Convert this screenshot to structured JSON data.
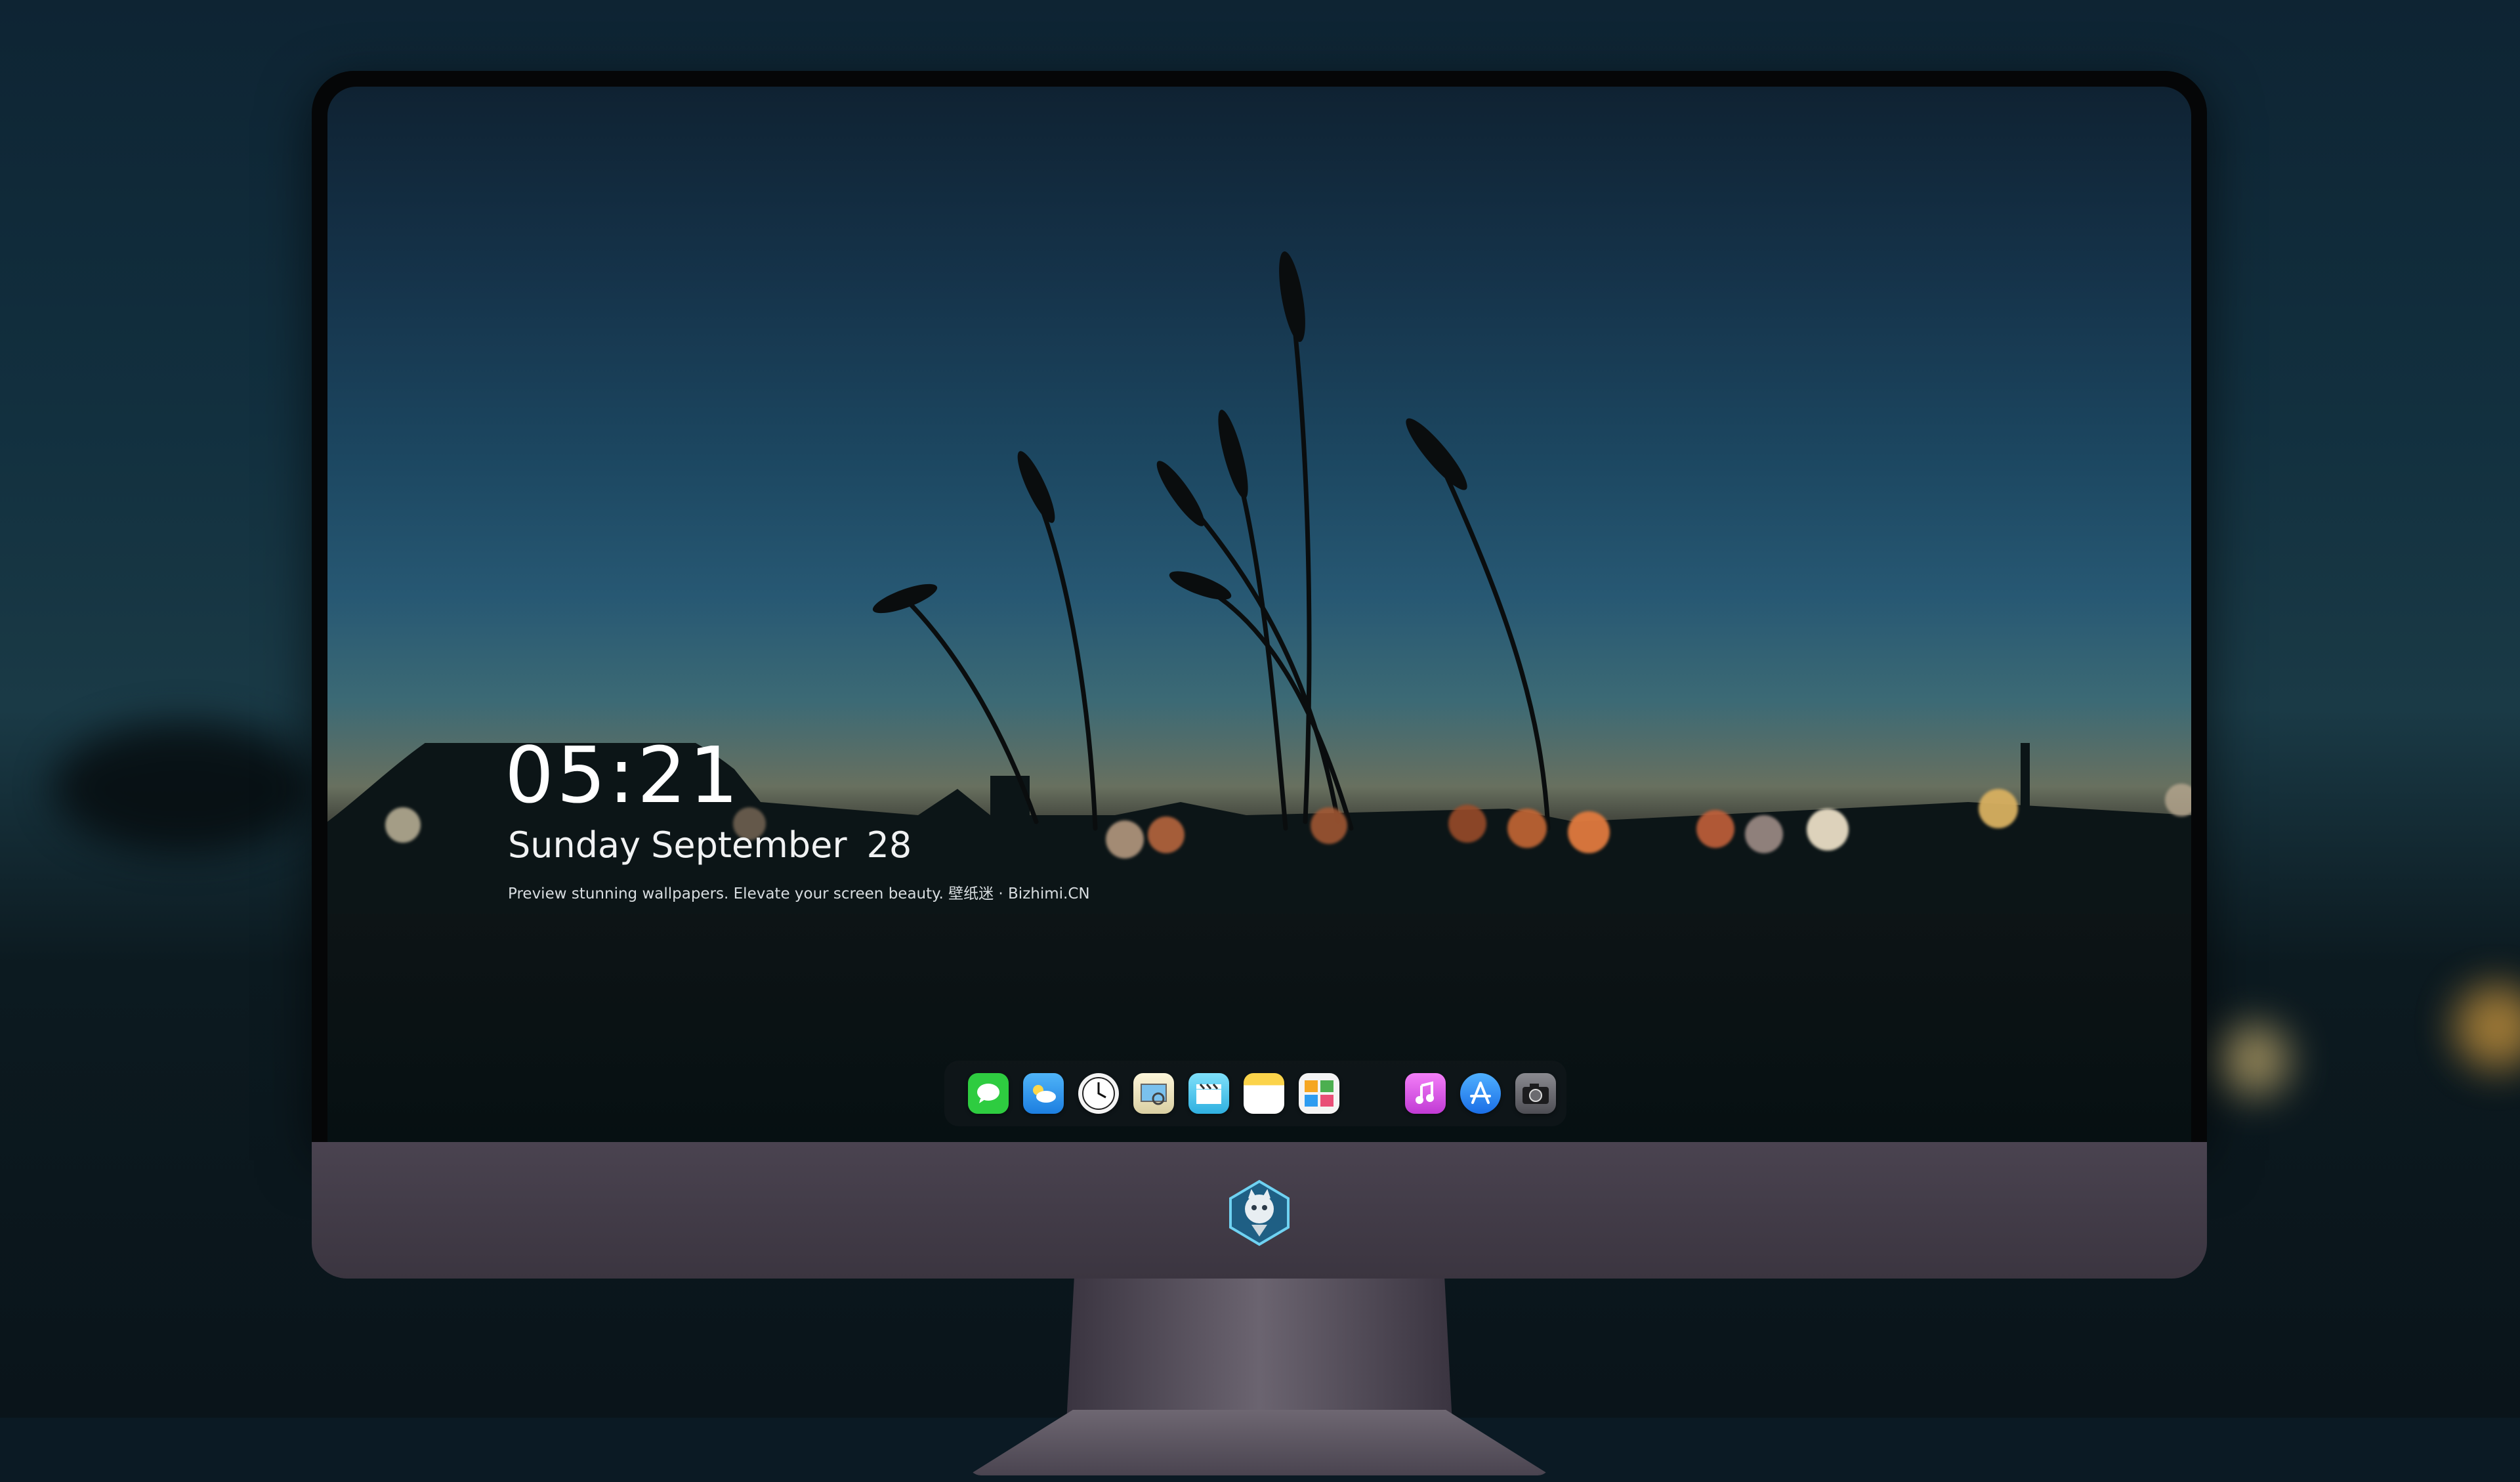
{
  "lockscreen": {
    "time": "05:21",
    "weekday": "Sunday",
    "month": "September",
    "day": "28",
    "tagline": "Preview stunning wallpapers. Elevate your screen beauty. 壁纸迷 · Bizhimi.CN"
  },
  "dock": {
    "apps": [
      {
        "name": "Messages",
        "icon": "messages-icon",
        "color": "#2ecc40"
      },
      {
        "name": "Weather",
        "icon": "weather-icon",
        "color": "#2d9cf0"
      },
      {
        "name": "Clock",
        "icon": "clock-icon",
        "color": "#f4f4f4"
      },
      {
        "name": "Preview",
        "icon": "preview-icon",
        "color": "#e9e3c7"
      },
      {
        "name": "Clips",
        "icon": "clapperboard-icon",
        "color": "#5dd0f0"
      },
      {
        "name": "Notes",
        "icon": "notes-icon",
        "color": "#fbd34a"
      },
      {
        "name": "Photo Booth",
        "icon": "photobooth-icon",
        "color": "#f0f0f0"
      },
      {
        "name": "iTunes",
        "icon": "music-icon",
        "color": "#e45ae8"
      },
      {
        "name": "App Store",
        "icon": "appstore-icon",
        "color": "#2a8bf2"
      },
      {
        "name": "Camera",
        "icon": "camera-icon",
        "color": "#6b6b70"
      }
    ]
  },
  "colors": {
    "chin": "#4a4350",
    "sky_top": "#0f2232",
    "horizon": "#68705f"
  }
}
